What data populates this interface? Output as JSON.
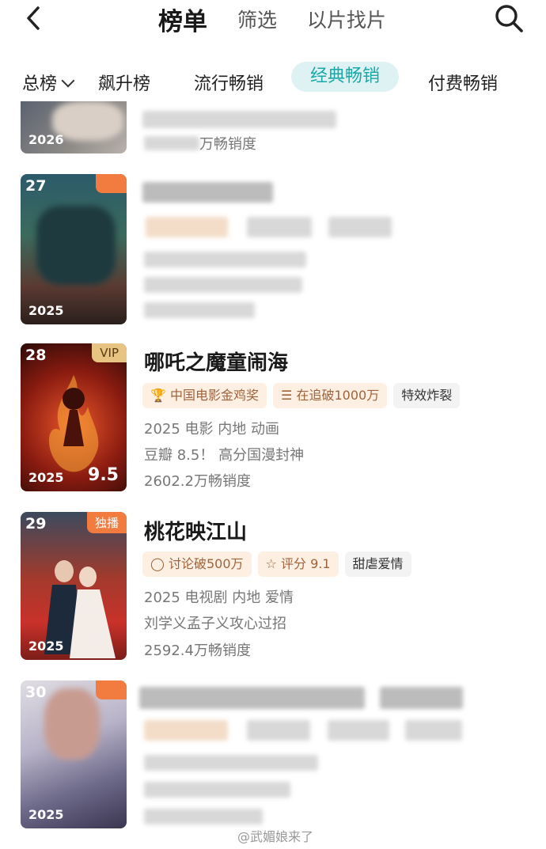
{
  "header": {
    "title": "榜单",
    "tab_filter": "筛选",
    "tab_find": "以片找片"
  },
  "tabs": {
    "total": "总榜",
    "rising": "飙升榜",
    "popular": "流行畅销",
    "classic": "经典畅销",
    "paid": "付费畅销"
  },
  "items": [
    {
      "poster_year": "2026",
      "sales_suffix": "万畅销度"
    },
    {
      "rank": "27",
      "poster_year": "2025"
    },
    {
      "rank": "28",
      "badge": "VIP",
      "title": "哪吒之魔童闹海",
      "poster_year": "2025",
      "score": "9.5",
      "tags": [
        "中国电影金鸡奖",
        "在追破1000万",
        "特效炸裂"
      ],
      "meta": "2025 电影 内地 动画",
      "desc": "豆瓣 8.5！ 高分国漫封神",
      "sales": "2602.2万畅销度"
    },
    {
      "rank": "29",
      "badge": "独播",
      "title": "桃花映江山",
      "poster_year": "2025",
      "tags": [
        "讨论破500万",
        "评分 9.1",
        "甜虐爱情"
      ],
      "meta": "2025 电视剧 内地 爱情",
      "desc": "刘学义孟子义攻心过招",
      "sales": "2592.4万畅销度"
    },
    {
      "rank": "30",
      "poster_year": "2025"
    }
  ],
  "watermark": "@武媚娘来了",
  "colors": {
    "accent": "#1ba7a8",
    "tab_bg": "#dff2f3",
    "vip": "#e8c483",
    "exclusive": "#f27b3f"
  }
}
